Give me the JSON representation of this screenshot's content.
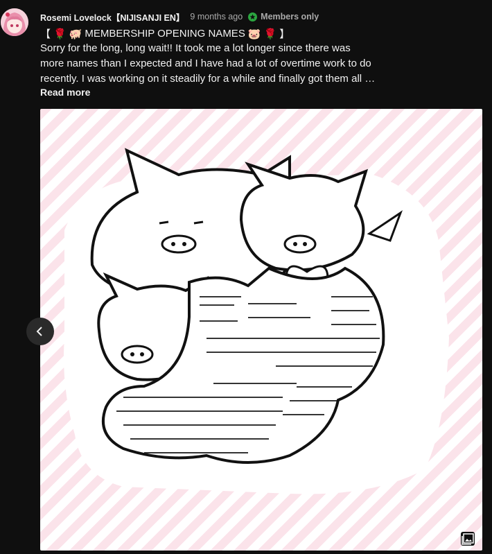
{
  "post": {
    "author": "Rosemi Lovelock【NIJISANJI EN】",
    "time": "9 months ago",
    "members_label": "Members only",
    "title": {
      "bracket_open": "【",
      "bracket_close": "】",
      "rose_emoji": "🌹",
      "pig_emoji": "🐖",
      "pig_face_emoji": "🐷",
      "text": "MEMBERSHIP OPENING NAMES"
    },
    "body_lines": [
      "Sorry for the long, long wait!! It took me a lot longer since there was",
      "more names than I expected and I have had a lot of overtime work to do",
      "recently. I was working on it steadily for a while and finally got them all …"
    ],
    "read_more": "Read more"
  },
  "icons": {
    "members_badge": "star-badge-icon",
    "prev": "chevron-left-icon",
    "gallery": "image-gallery-icon"
  },
  "colors": {
    "background": "#0f0f0f",
    "members_badge": "#2ba640",
    "stripe_pink": "#fbe3ea"
  }
}
